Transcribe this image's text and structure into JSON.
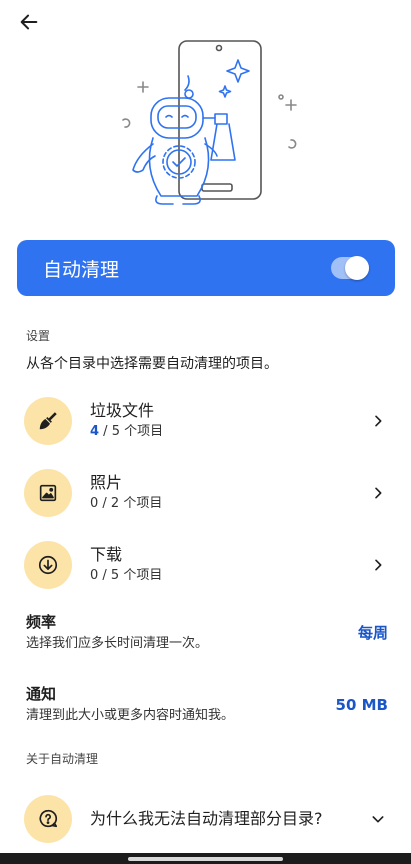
{
  "header": {
    "back_icon": "arrow-left-icon"
  },
  "hero": {
    "illustration": "robot-cleaning-phone-illustration"
  },
  "auto_clean": {
    "title": "自动清理",
    "enabled": true,
    "accent": "#2f73f0"
  },
  "settings": {
    "label": "设置",
    "description": "从各个目录中选择需要自动清理的项目。",
    "items": [
      {
        "icon": "broom-icon",
        "title": "垃圾文件",
        "selected": "4",
        "rest": " / 5 个项目"
      },
      {
        "icon": "image-icon",
        "title": "照片",
        "selected": "0",
        "rest": " / 2 个项目"
      },
      {
        "icon": "download-icon",
        "title": "下载",
        "selected": "0",
        "rest": " / 5 个项目"
      }
    ]
  },
  "frequency": {
    "title": "频率",
    "subtitle": "选择我们应多长时间清理一次。",
    "value": "每周"
  },
  "notify": {
    "title": "通知",
    "subtitle": "清理到此大小或更多内容时通知我。",
    "value": "50 MB"
  },
  "about": {
    "label": "关于自动清理",
    "faq": {
      "icon": "question-bubble-icon",
      "title": "为什么我无法自动清理部分目录?"
    }
  },
  "colors": {
    "accent": "#2f73f0",
    "link": "#1a56c8",
    "icon_bg": "#fce3a8"
  }
}
